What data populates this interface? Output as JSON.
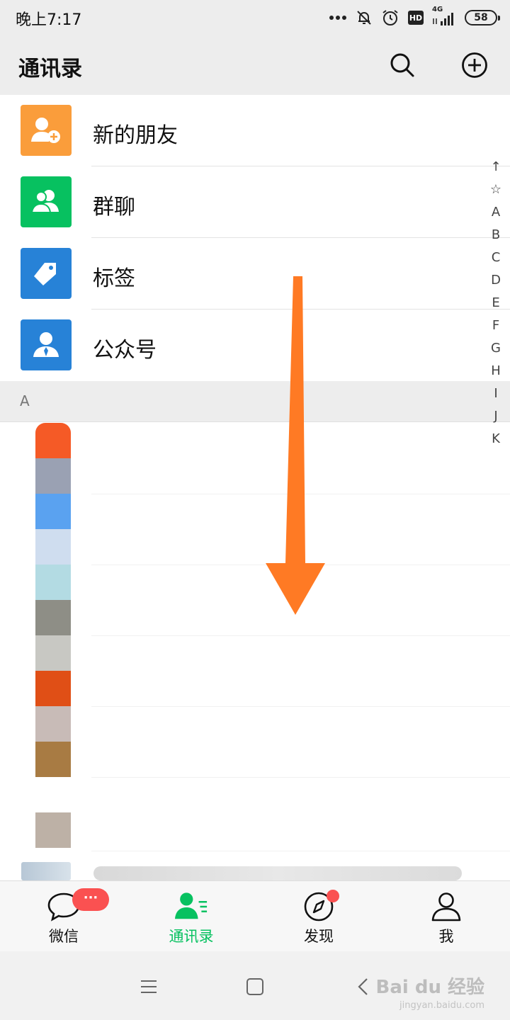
{
  "status_bar": {
    "time": "晚上7:17",
    "network": "4G",
    "hd": "HD",
    "battery": "58"
  },
  "header": {
    "title": "通讯录",
    "search_icon": "search-icon",
    "add_icon": "plus-circle-icon"
  },
  "top_items": [
    {
      "label": "新的朋友",
      "icon": "add-friend-icon",
      "color": "#fa9d3b"
    },
    {
      "label": "群聊",
      "icon": "group-chat-icon",
      "color": "#07c160"
    },
    {
      "label": "标签",
      "icon": "tag-icon",
      "color": "#2782d7"
    },
    {
      "label": "公众号",
      "icon": "official-account-icon",
      "color": "#2782d7"
    }
  ],
  "section": {
    "letter": "A"
  },
  "alphabet_index": [
    "↑",
    "☆",
    "A",
    "B",
    "C",
    "D",
    "E",
    "F",
    "G",
    "H",
    "I",
    "J",
    "K"
  ],
  "blurred_avatar_colors": [
    "#f55a26",
    "#9aa1b3",
    "#5aa2f0",
    "#cfddef",
    "#b3dbe3",
    "#8e8e86",
    "#c8c8c3",
    "#e04f16",
    "#c8bbb7",
    "#a87b43",
    "#ffffff",
    "#bdb1a6"
  ],
  "tabs": [
    {
      "label": "微信",
      "icon": "chat-bubble-icon",
      "badge": "···"
    },
    {
      "label": "通讯录",
      "icon": "contacts-icon",
      "active": true
    },
    {
      "label": "发现",
      "icon": "compass-icon"
    },
    {
      "label": "我",
      "icon": "person-icon"
    }
  ],
  "accent_color": "#07c160",
  "arrow_color": "#ff7a24",
  "watermark": {
    "main": "Bai du 经验",
    "sub": "jingyan.baidu.com"
  }
}
